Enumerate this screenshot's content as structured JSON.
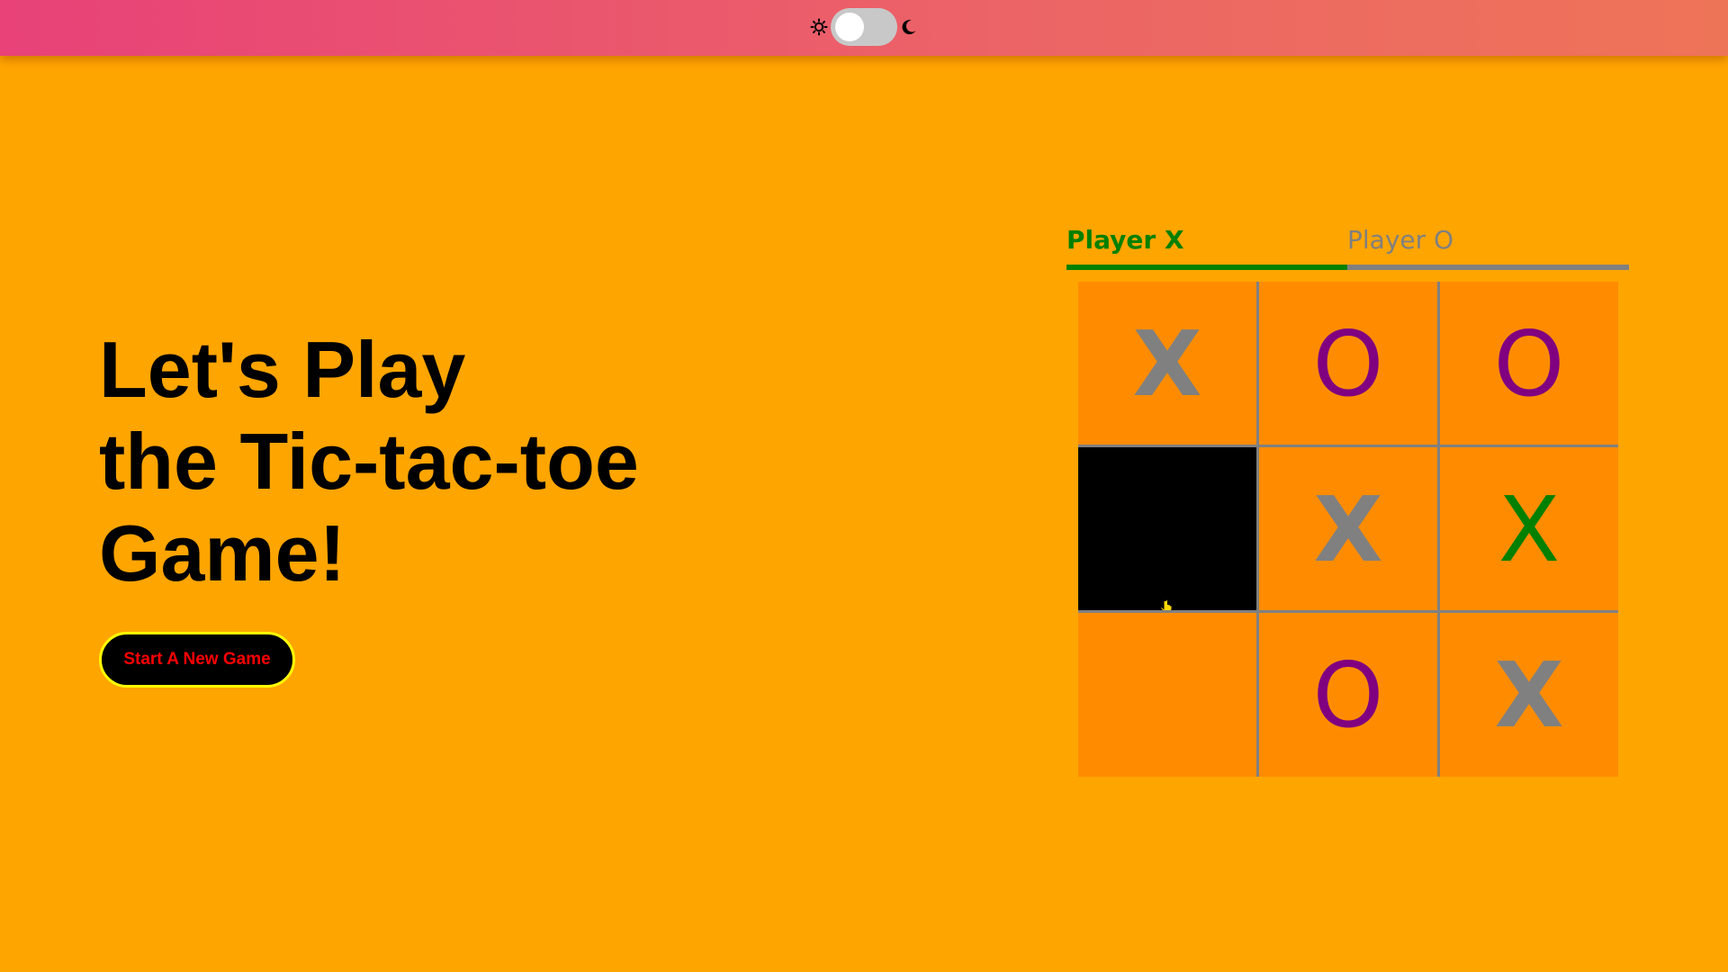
{
  "header": {
    "theme_toggle": {
      "state": "off",
      "sun_icon": "sun-icon",
      "moon_icon": "moon-icon"
    }
  },
  "hero": {
    "title_line1": "Let's Play",
    "title_line2": "the Tic-tac-toe",
    "title_line3": "Game!",
    "new_game_label": "Start A New Game"
  },
  "players": {
    "x_label": "Player X",
    "o_label": "Player O",
    "active": "X"
  },
  "board": {
    "cells": [
      {
        "mark": "X",
        "style": "gray"
      },
      {
        "mark": "O",
        "style": "purple"
      },
      {
        "mark": "O",
        "style": "purple"
      },
      {
        "mark": "",
        "style": "hover"
      },
      {
        "mark": "X",
        "style": "gray"
      },
      {
        "mark": "X",
        "style": "green"
      },
      {
        "mark": "",
        "style": "empty"
      },
      {
        "mark": "O",
        "style": "purple"
      },
      {
        "mark": "X",
        "style": "gray"
      }
    ]
  },
  "colors": {
    "page_bg": "#FFA500",
    "cell_bg": "#FF8C00",
    "active_player": "#008000",
    "inactive_player": "#808080",
    "o_mark": "#800080",
    "button_text": "#FF0000",
    "button_border": "#FFFF00"
  }
}
